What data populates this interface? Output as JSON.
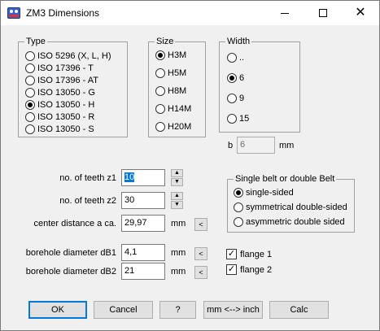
{
  "window": {
    "title": "ZM3 Dimensions"
  },
  "type_group": {
    "legend": "Type",
    "options": [
      {
        "label": "ISO 5296 (X, L, H)",
        "checked": false
      },
      {
        "label": "ISO 17396 - T",
        "checked": false
      },
      {
        "label": "ISO 17396 - AT",
        "checked": false
      },
      {
        "label": "ISO 13050 - G",
        "checked": false
      },
      {
        "label": "ISO 13050 - H",
        "checked": true
      },
      {
        "label": "ISO 13050 - R",
        "checked": false
      },
      {
        "label": "ISO 13050 - S",
        "checked": false
      }
    ]
  },
  "size_group": {
    "legend": "Size",
    "options": [
      {
        "label": "H3M",
        "checked": true
      },
      {
        "label": "H5M",
        "checked": false
      },
      {
        "label": "H8M",
        "checked": false
      },
      {
        "label": "H14M",
        "checked": false
      },
      {
        "label": "H20M",
        "checked": false
      }
    ]
  },
  "width_group": {
    "legend": "Width",
    "options": [
      {
        "label": "..",
        "checked": false
      },
      {
        "label": "6",
        "checked": true
      },
      {
        "label": "9",
        "checked": false
      },
      {
        "label": "15",
        "checked": false
      }
    ]
  },
  "b_field": {
    "label": "b",
    "value": "6",
    "unit": "mm"
  },
  "teeth_z1": {
    "label": "no. of teeth z1",
    "value": "10"
  },
  "teeth_z2": {
    "label": "no. of teeth z2",
    "value": "30"
  },
  "center_distance": {
    "label": "center distance a ca.",
    "value": "29,97",
    "unit": "mm",
    "button": "<"
  },
  "borehole_b1": {
    "label": "borehole diameter dB1",
    "value": "4,1",
    "unit": "mm",
    "button": "<"
  },
  "borehole_b2": {
    "label": "borehole diameter dB2",
    "value": "21",
    "unit": "mm",
    "button": "<"
  },
  "belt_group": {
    "legend": "Single belt or double Belt",
    "options": [
      {
        "label": "single-sided",
        "checked": true
      },
      {
        "label": "symmetrical double-sided",
        "checked": false
      },
      {
        "label": "asymmetric double sided",
        "checked": false
      }
    ]
  },
  "flange1": {
    "label": "flange 1",
    "checked": true
  },
  "flange2": {
    "label": "flange 2",
    "checked": true
  },
  "buttons": {
    "ok": "OK",
    "cancel": "Cancel",
    "help": "?",
    "convert": "mm <--> inch",
    "calc": "Calc"
  },
  "icons": {
    "spin_up": "▲",
    "spin_down": "▼",
    "check": "✓",
    "close": "✕"
  }
}
